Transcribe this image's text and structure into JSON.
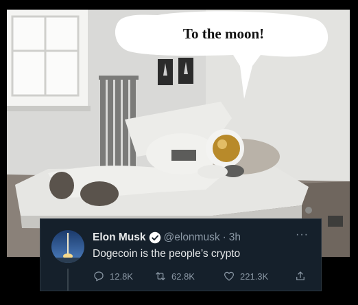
{
  "meme": {
    "caption": "To the moon!"
  },
  "tweet": {
    "display_name": "Elon Musk",
    "handle": "@elonmusk",
    "separator": "·",
    "time": "3h",
    "more_label": "···",
    "text": "Dogecoin is the people’s crypto",
    "reply_count": "12.8K",
    "retweet_count": "62.8K",
    "like_count": "221.3K"
  },
  "icons": {
    "verified": "verified-badge-icon",
    "reply": "reply-icon",
    "retweet": "retweet-icon",
    "like": "heart-icon",
    "share": "share-icon"
  },
  "colors": {
    "tweet_background": "#15202b",
    "verified_badge": "#ffffff",
    "muted_text": "#8b98a5"
  }
}
